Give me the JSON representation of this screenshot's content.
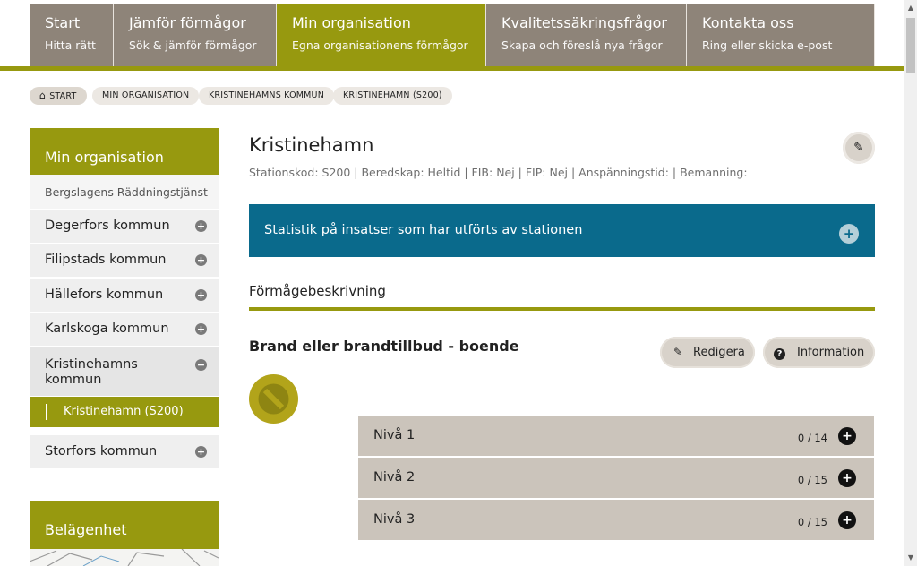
{
  "nav": {
    "tabs": [
      {
        "title": "Start",
        "subtitle": "Hitta rätt"
      },
      {
        "title": "Jämför förmågor",
        "subtitle": "Sök & jämför förmågor"
      },
      {
        "title": "Min organisation",
        "subtitle": "Egna organisationens förmågor",
        "active": true
      },
      {
        "title": "Kvalitetssäkringsfrågor",
        "subtitle": "Skapa och föreslå nya frågor"
      },
      {
        "title": "Kontakta oss",
        "subtitle": "Ring eller skicka e-post"
      }
    ]
  },
  "breadcrumb": [
    "Start",
    "Min organisation",
    "Kristinehamns kommun",
    "Kristinehamn (S200)"
  ],
  "sidebar": {
    "header": "Min organisation",
    "org_label": "Bergslagens Räddningstjänst",
    "items": [
      {
        "label": "Degerfors kommun",
        "toggle": "+"
      },
      {
        "label": "Filipstads kommun",
        "toggle": "+"
      },
      {
        "label": "Hällefors kommun",
        "toggle": "+"
      },
      {
        "label": "Karlskoga kommun",
        "toggle": "+"
      },
      {
        "label": "Kristinehamns kommun",
        "toggle": "−"
      },
      {
        "label": "Storfors kommun",
        "toggle": "+"
      }
    ],
    "sub_item": "Kristinehamn (S200)",
    "location_header": "Belägenhet"
  },
  "main": {
    "title": "Kristinehamn",
    "meta": "Stationskod: S200 |  Beredskap: Heltid |  FIB: Nej |  FIP: Nej |  Anspänningstid:   |  Bemanning:",
    "statistics_label": "Statistik på insatser som har utförts av stationen",
    "section_title": "Förmågebeskrivning",
    "capability_title": "Brand eller brandtillbud - boende",
    "edit_label": "Redigera",
    "info_label": "Information",
    "levels": [
      {
        "label": "Nivå 1",
        "count": "0 / 14"
      },
      {
        "label": "Nivå 2",
        "count": "0 / 15"
      },
      {
        "label": "Nivå 3",
        "count": "0 / 15"
      }
    ]
  },
  "colors": {
    "accent": "#97990f",
    "nav": "#8e8479",
    "stat": "#0a6a8c",
    "level": "#cbc4bb"
  },
  "icons": [
    "home-icon",
    "pencil-icon",
    "question-icon",
    "plus-circle-icon",
    "minus-circle-icon",
    "status-circle-icon"
  ]
}
